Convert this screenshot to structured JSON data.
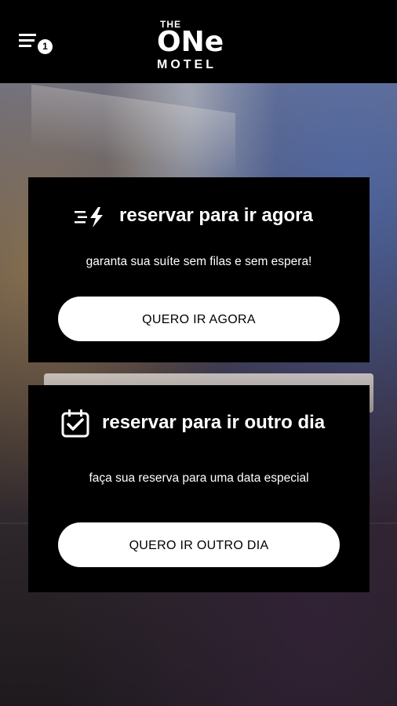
{
  "header": {
    "menu_icon": "filter-list-icon",
    "menu_badge": "1",
    "logo": {
      "line1": "THE",
      "line2": "ONe",
      "line3": "MOTEL"
    }
  },
  "cards": [
    {
      "icon": "fast-lightning-icon",
      "title": "reservar para ir agora",
      "subtitle": "garanta sua suíte sem filas e sem espera!",
      "button_label": "QUERO IR AGORA"
    },
    {
      "icon": "calendar-check-icon",
      "title": "reservar para ir outro dia",
      "subtitle": "faça sua reserva para uma data especial",
      "button_label": "QUERO IR OUTRO DIA"
    }
  ],
  "colors": {
    "header_bg": "#000000",
    "card_bg": "#000000",
    "button_bg": "#ffffff",
    "text_primary": "#ffffff"
  }
}
